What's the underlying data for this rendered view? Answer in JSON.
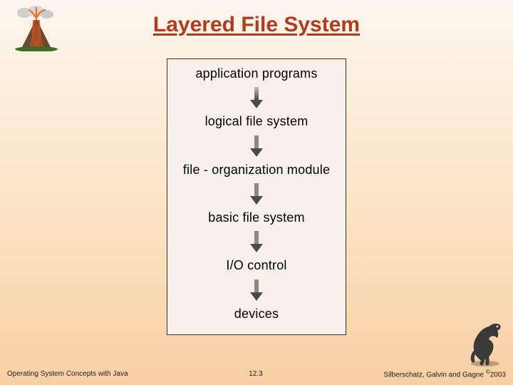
{
  "title": "Layered File System",
  "layers": [
    "application programs",
    "logical file system",
    "file - organization module",
    "basic file system",
    "I/O control",
    "devices"
  ],
  "footer": {
    "left": "Operating System Concepts with Java",
    "center": "12.3",
    "right_prefix": "Silberschatz, Galvin and Gagne ",
    "right_mark": "©",
    "right_year": "2003"
  }
}
